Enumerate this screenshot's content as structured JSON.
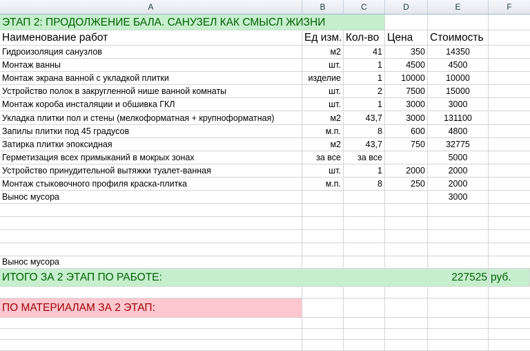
{
  "columns": [
    "A",
    "B",
    "C",
    "D",
    "E",
    "F"
  ],
  "title": "ЭТАП 2: ПРОДОЛЖЕНИЕ БАЛА. САНУЗЕЛ КАК СМЫСЛ ЖИЗНИ",
  "header": {
    "name": "Наименование работ",
    "unit": "Ед изм.",
    "qty": "Кол-во",
    "price": "Цена",
    "cost": "Стоимость"
  },
  "rows": [
    {
      "name": "Гидроизоляция санузлов",
      "unit": "м2",
      "qty": "41",
      "price": "350",
      "cost": "14350"
    },
    {
      "name": "Монтаж ванны",
      "unit": "шт.",
      "qty": "1",
      "price": "4500",
      "cost": "4500"
    },
    {
      "name": "Монтаж экрана ванной с укладкой плитки",
      "unit": "изделие",
      "qty": "1",
      "price": "10000",
      "cost": "10000"
    },
    {
      "name": "Устройство полок в закругленной нише ванной комнаты",
      "unit": "шт.",
      "qty": "2",
      "price": "7500",
      "cost": "15000"
    },
    {
      "name": "Монтаж короба инсталяции и обшивка ГКЛ",
      "unit": "шт.",
      "qty": "1",
      "price": "3000",
      "cost": "3000"
    },
    {
      "name": "Укладка плитки пол и стены (мелкоформатная + крупноформатная)",
      "unit": "м2",
      "qty": "43,7",
      "price": "3000",
      "cost": "131100"
    },
    {
      "name": "Запилы плитки под 45 градусов",
      "unit": "м.п.",
      "qty": "8",
      "price": "600",
      "cost": "4800"
    },
    {
      "name": "Затирка плитки эпоксидная",
      "unit": "м2",
      "qty": "43,7",
      "price": "750",
      "cost": "32775"
    },
    {
      "name": "Герметизация всех примыканий в мокрых зонах",
      "unit": "за все",
      "qty": "за все",
      "price": "",
      "cost": "5000"
    },
    {
      "name": "Устройство принудительной вытяжки туалет-ванная",
      "unit": "шт.",
      "qty": "1",
      "price": "2000",
      "cost": "2000"
    },
    {
      "name": "Монтаж стыковочного профиля краска-плитка",
      "unit": "м.п.",
      "qty": "8",
      "price": "250",
      "cost": "2000"
    },
    {
      "name": "Вынос мусора",
      "unit": "",
      "qty": "",
      "price": "",
      "cost": "3000"
    }
  ],
  "extra_label": "Вынос мусора",
  "total": {
    "label": "ИТОГО ЗА 2 ЭТАП ПО РАБОТЕ:",
    "value": "227525",
    "currency": "руб."
  },
  "materials": {
    "label": "ПО МАТЕРИАЛАМ ЗА 2 ЭТАП:"
  },
  "colors": {
    "green_fill": "#c6efce",
    "green_text": "#006100",
    "pink_fill": "#ffc7ce",
    "pink_text": "#9c0006"
  }
}
